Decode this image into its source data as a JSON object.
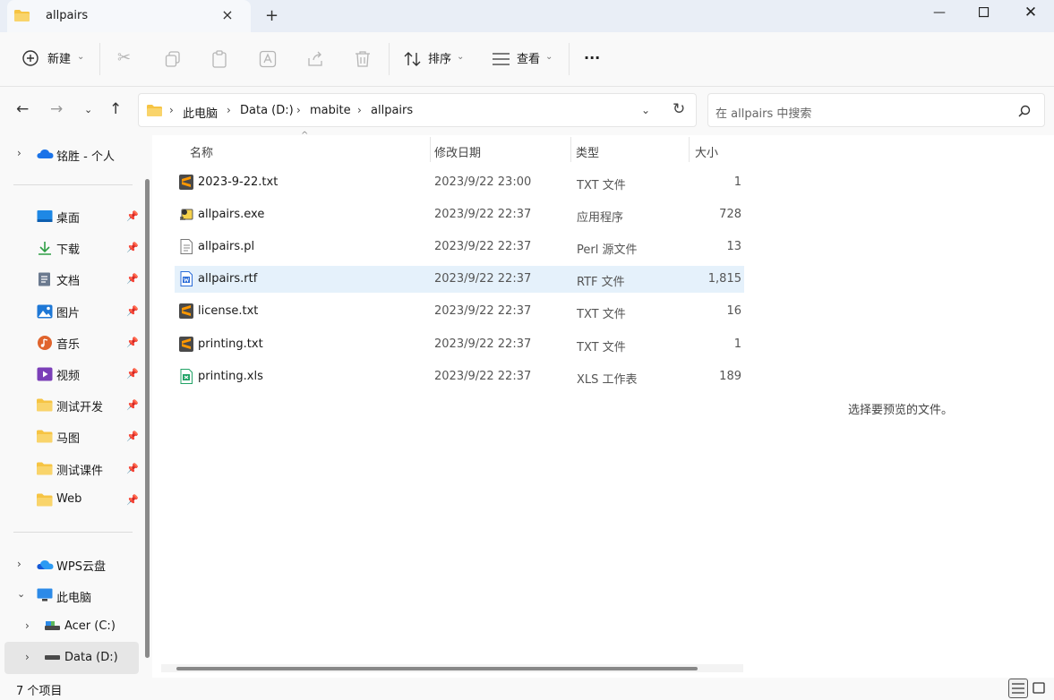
{
  "window": {
    "tab_title": "allpairs",
    "new_tab": "+",
    "close": "×"
  },
  "toolbar": {
    "new_label": "新建",
    "sort_label": "排序",
    "view_label": "查看",
    "more_label": "···"
  },
  "address": {
    "segments": [
      "此电脑",
      "Data (D:)",
      "mabite",
      "allpairs"
    ]
  },
  "search": {
    "placeholder": "在 allpairs 中搜索"
  },
  "sidebar": {
    "onedrive": "铭胜 - 个人",
    "quick": [
      {
        "label": "桌面",
        "icon": "desktop-icon",
        "color": "#1e88e5"
      },
      {
        "label": "下载",
        "icon": "download-icon",
        "color": "#2e9e44"
      },
      {
        "label": "文档",
        "icon": "document-icon",
        "color": "#6b7a8f"
      },
      {
        "label": "图片",
        "icon": "picture-icon",
        "color": "#1e78d6"
      },
      {
        "label": "音乐",
        "icon": "music-icon",
        "color": "#e0642d"
      },
      {
        "label": "视频",
        "icon": "video-icon",
        "color": "#7b3fb8"
      },
      {
        "label": "测试开发",
        "icon": "folder-icon",
        "color": "#f6c443"
      },
      {
        "label": "马图",
        "icon": "folder-icon",
        "color": "#f6c443"
      },
      {
        "label": "测试课件",
        "icon": "folder-icon",
        "color": "#f6c443"
      },
      {
        "label": "Web",
        "icon": "folder-icon",
        "color": "#f6c443"
      }
    ],
    "wps": "WPS云盘",
    "this_pc": "此电脑",
    "drive_c": "Acer (C:)",
    "drive_d": "Data (D:)"
  },
  "columns": {
    "name": "名称",
    "date": "修改日期",
    "type": "类型",
    "size": "大小"
  },
  "files": [
    {
      "name": "2023-9-22.txt",
      "date": "2023/9/22 23:00",
      "type": "TXT 文件",
      "size": "1",
      "icon": "sublime-icon"
    },
    {
      "name": "allpairs.exe",
      "date": "2023/9/22 22:37",
      "type": "应用程序",
      "size": "728",
      "icon": "exe-icon"
    },
    {
      "name": "allpairs.pl",
      "date": "2023/9/22 22:37",
      "type": "Perl 源文件",
      "size": "13",
      "icon": "text-file-icon"
    },
    {
      "name": "allpairs.rtf",
      "date": "2023/9/22 22:37",
      "type": "RTF 文件",
      "size": "1,815",
      "icon": "word-doc-icon"
    },
    {
      "name": "license.txt",
      "date": "2023/9/22 22:37",
      "type": "TXT 文件",
      "size": "16",
      "icon": "sublime-icon"
    },
    {
      "name": "printing.txt",
      "date": "2023/9/22 22:37",
      "type": "TXT 文件",
      "size": "1",
      "icon": "sublime-icon"
    },
    {
      "name": "printing.xls",
      "date": "2023/9/22 22:37",
      "type": "XLS 工作表",
      "size": "189",
      "icon": "spreadsheet-icon"
    }
  ],
  "preview_text": "选择要预览的文件。",
  "status": {
    "count": "7 个项目"
  },
  "colors": {
    "accent": "#0067c0",
    "selected_row": "#e5f1fb",
    "folder": "#f6c443"
  }
}
